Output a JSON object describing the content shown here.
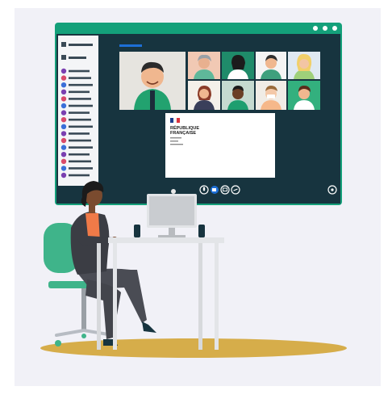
{
  "document": {
    "header_line1": "RÉPUBLIQUE",
    "header_line2": "FRANÇAISE"
  },
  "colors": {
    "window_green": "#14a07a",
    "screen_dark": "#17343f",
    "accent_green": "#1e9e6f",
    "chair_green": "#3fb48a",
    "floor_gold": "#d6ad4a",
    "blazer_dark": "#3b3d44",
    "blouse_orange": "#f07a48"
  },
  "icons": {
    "window_controls": [
      "window-dot-icon",
      "window-dot-icon",
      "window-dot-icon"
    ],
    "call_controls": [
      "microphone-icon",
      "camera-icon",
      "share-screen-icon",
      "hangup-icon"
    ],
    "settings": "settings-icon"
  }
}
